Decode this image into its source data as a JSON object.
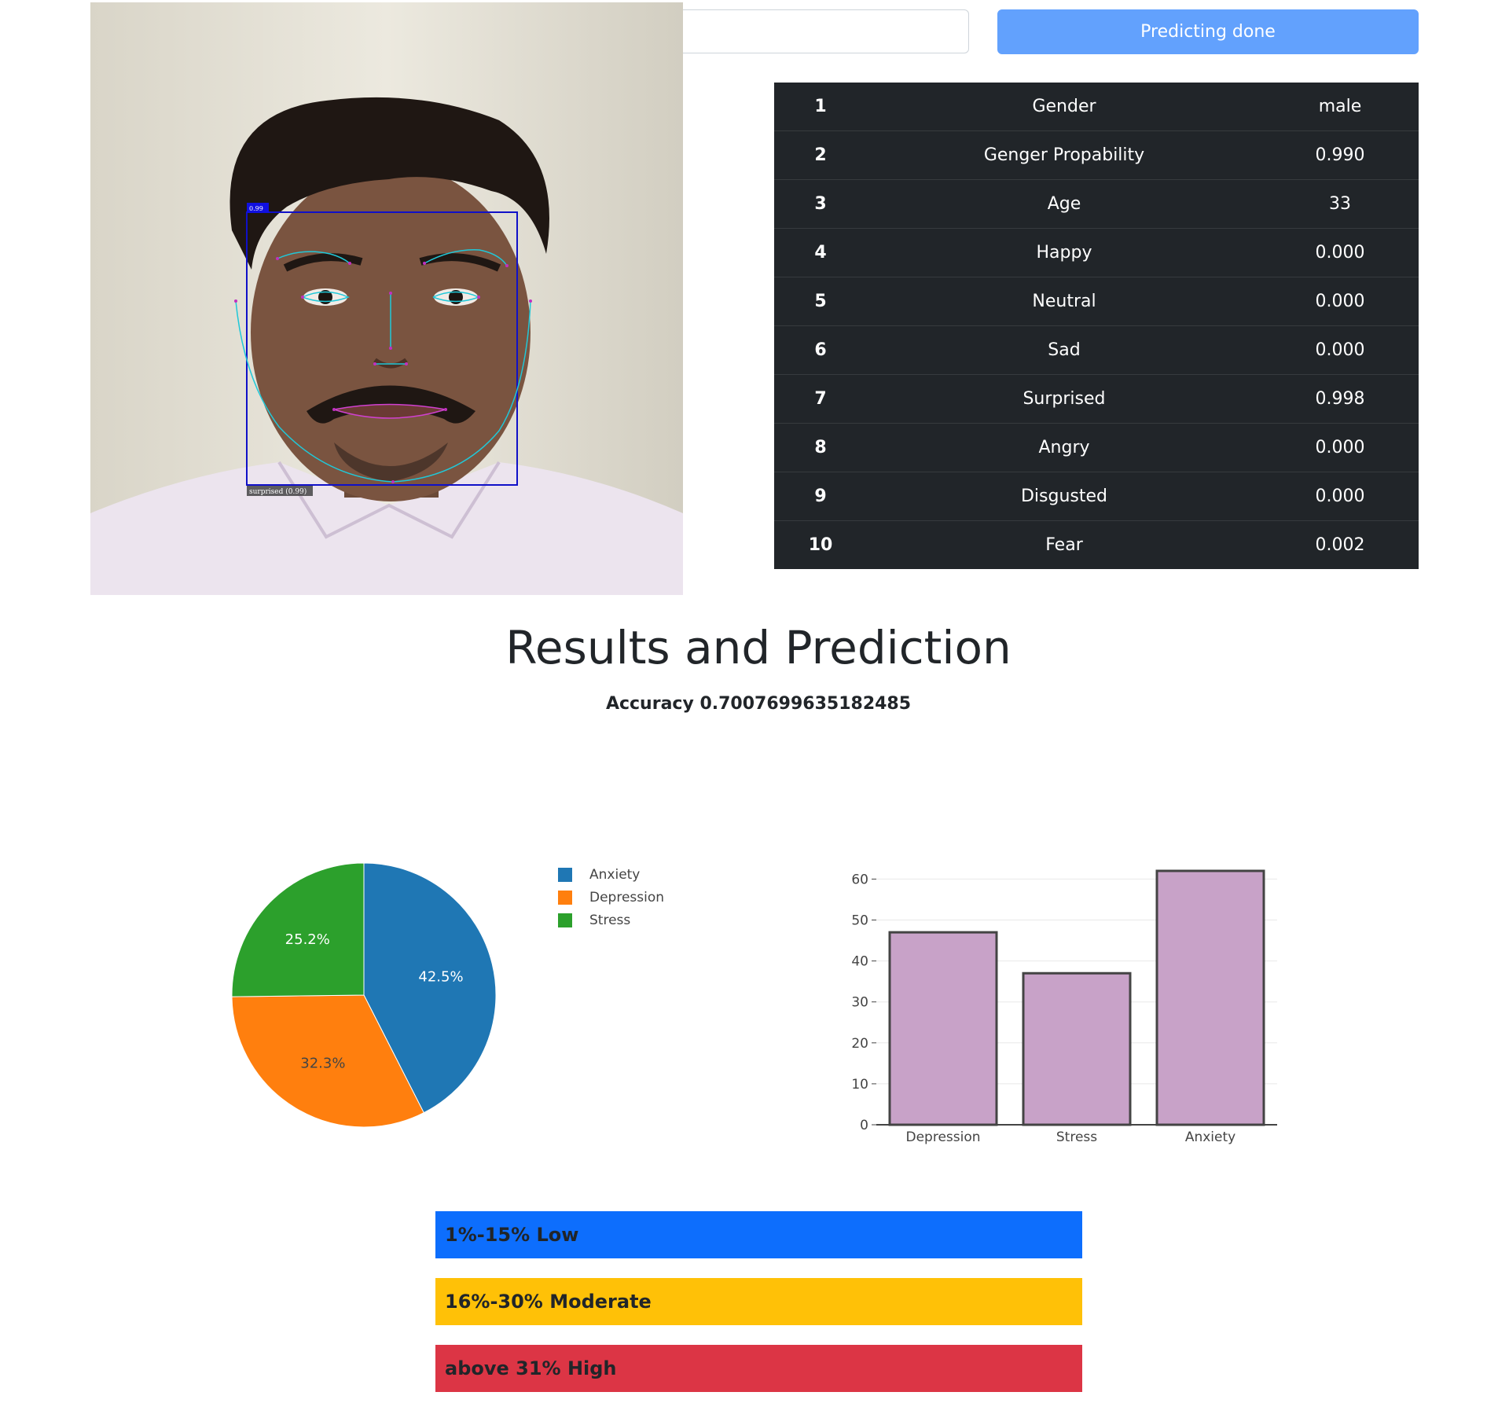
{
  "upload": {
    "file_value": ""
  },
  "predict_button": {
    "label": "Predicting done"
  },
  "face_detection": {
    "score_badge": "0.99",
    "expression_label": "surprised (0.99)"
  },
  "result_table": {
    "rows": [
      {
        "index": "1",
        "label": "Gender",
        "value": "male"
      },
      {
        "index": "2",
        "label": "Genger Propability",
        "value": "0.990"
      },
      {
        "index": "3",
        "label": "Age",
        "value": "33"
      },
      {
        "index": "4",
        "label": "Happy",
        "value": "0.000"
      },
      {
        "index": "5",
        "label": "Neutral",
        "value": "0.000"
      },
      {
        "index": "6",
        "label": "Sad",
        "value": "0.000"
      },
      {
        "index": "7",
        "label": "Surprised",
        "value": "0.998"
      },
      {
        "index": "8",
        "label": "Angry",
        "value": "0.000"
      },
      {
        "index": "9",
        "label": "Disgusted",
        "value": "0.000"
      },
      {
        "index": "10",
        "label": "Fear",
        "value": "0.002"
      }
    ]
  },
  "results": {
    "title": "Results and Prediction",
    "accuracy_text": "Accuracy 0.7007699635182485"
  },
  "chart_data": [
    {
      "type": "pie",
      "categories": [
        "Anxiety",
        "Depression",
        "Stress"
      ],
      "values": [
        42.5,
        32.3,
        25.2
      ],
      "labels": [
        "42.5%",
        "32.3%",
        "25.2%"
      ],
      "colors": [
        "#1f77b4",
        "#ff7f0e",
        "#2ca02c"
      ],
      "legend": "right"
    },
    {
      "type": "bar",
      "categories": [
        "Depression",
        "Stress",
        "Anxiety"
      ],
      "values": [
        47,
        37,
        62
      ],
      "ylim": [
        0,
        62
      ],
      "yticks": [
        0,
        10,
        20,
        30,
        40,
        50,
        60
      ],
      "grid": true,
      "bar_color": "#c8a2c8",
      "bar_outline": "#444444"
    }
  ],
  "risk_levels": [
    {
      "label": "1%-15% Low",
      "color": "#0d6efd"
    },
    {
      "label": "16%-30% Moderate",
      "color": "#ffc107"
    },
    {
      "label": "above 31% High",
      "color": "#dc3545"
    }
  ]
}
